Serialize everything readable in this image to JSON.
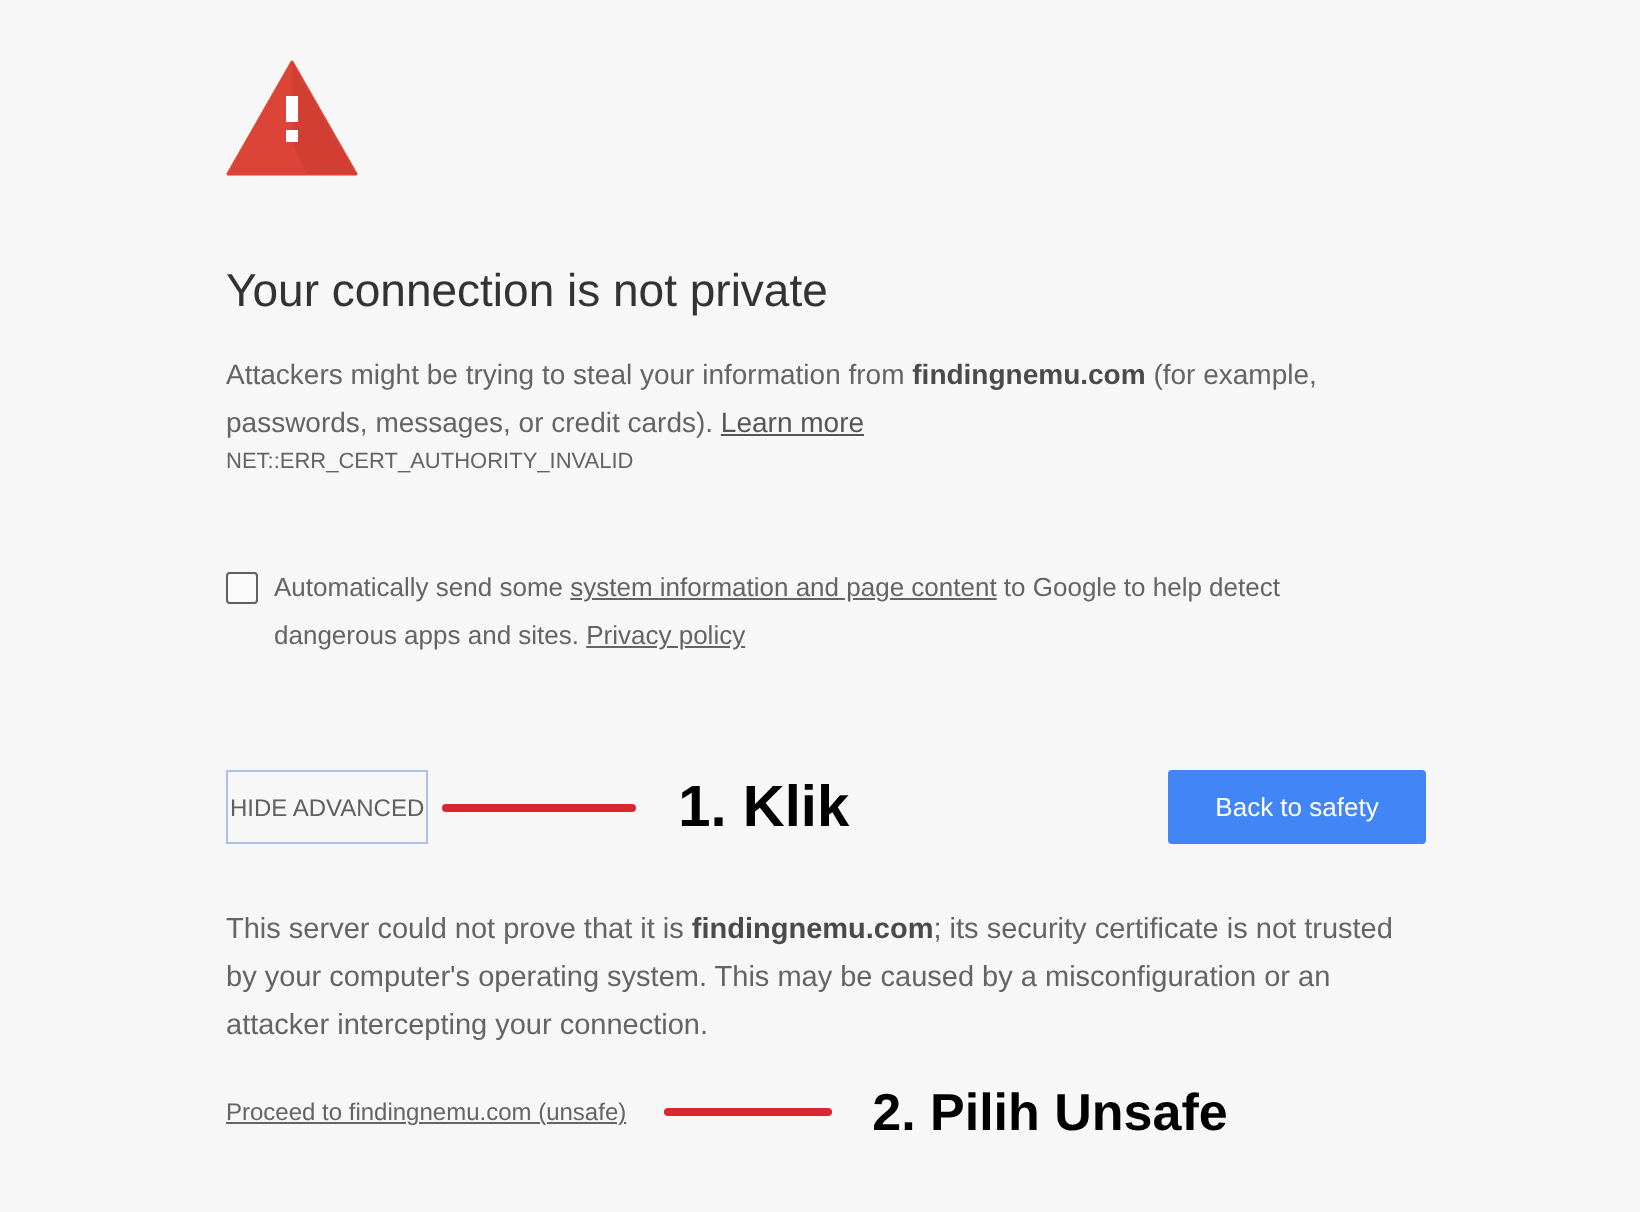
{
  "warning": {
    "title": "Your connection is not private",
    "message": "Attackers might be trying to steal your information from **findingnemu.com** (for example, passwords, messages, or credit cards).",
    "learn_more_link": "Learn more",
    "error_code": "NET::ERR_CERT_AUTHORITY_INVALID"
  },
  "report_option": {
    "checked": false,
    "text_before": "Automatically send some",
    "link": "system information and page content",
    "text_after": "to Google to help detect dangerous apps and sites.",
    "privacy_link": "Privacy policy"
  },
  "buttons": [
    {
      "kind": "secondary",
      "label": "HIDE ADVANCED",
      "callout": "1. Klik"
    },
    {
      "kind": "primary",
      "label": "Back to safety"
    }
  ],
  "details": {
    "message": "This server could not prove that it is **findingnemu.com**; its security certificate is not trusted by your computer's operating system. This may be caused by a misconfiguration or an attacker intercepting your connection.",
    "proceed_link": "Proceed to findingnemu.com (unsafe)",
    "callout": "2. Pilih Unsafe"
  }
}
